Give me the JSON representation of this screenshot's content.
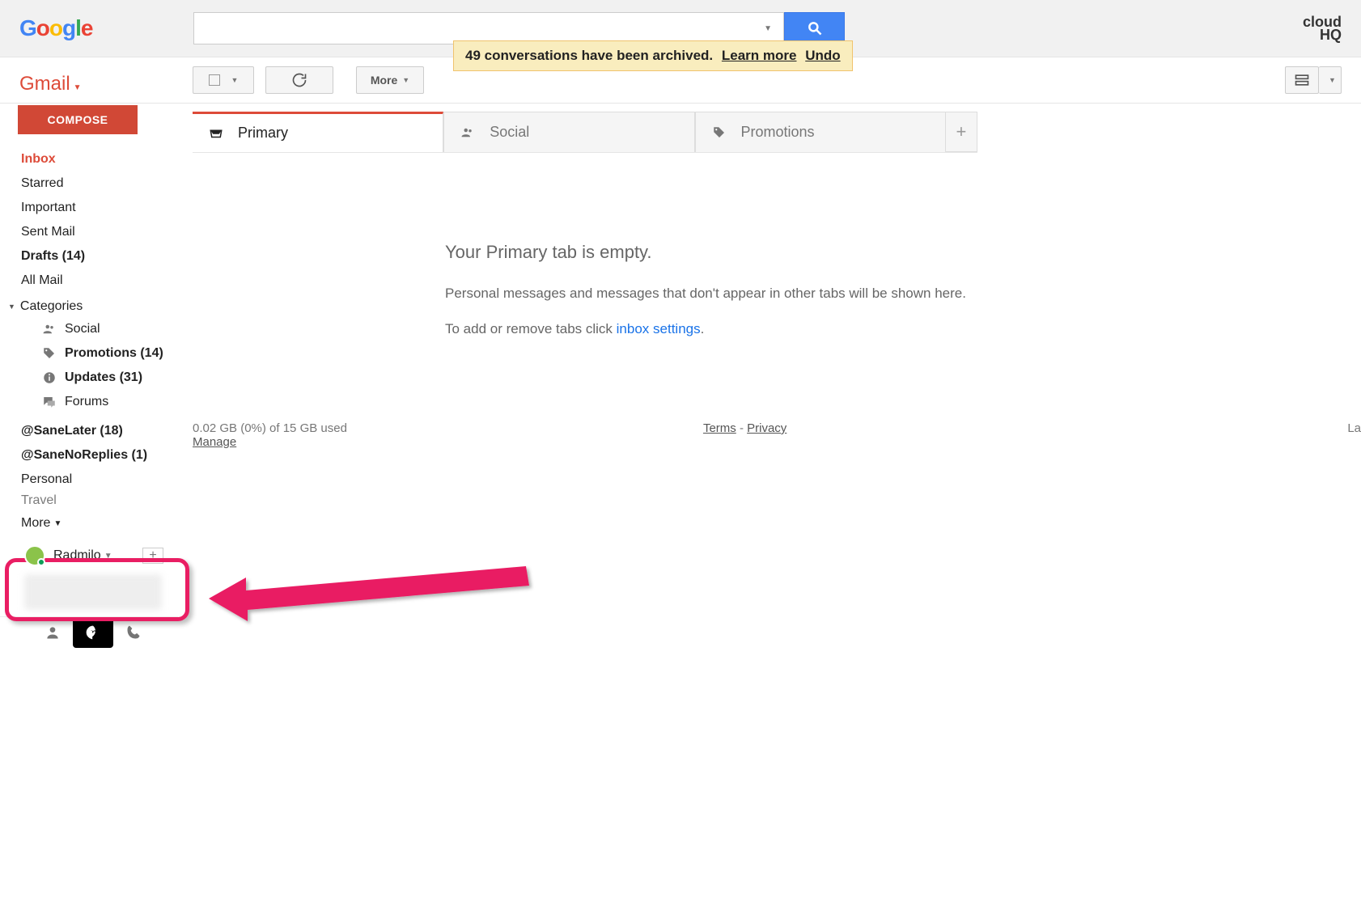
{
  "header": {
    "logo_text": "Google",
    "cloudhq_line1": "cloud",
    "cloudhq_line2": "HQ"
  },
  "notification": {
    "message": "49 conversations have been archived.",
    "learn_more": "Learn more",
    "undo": "Undo"
  },
  "toolbar": {
    "more_label": "More"
  },
  "gmail_label": "Gmail",
  "compose_label": "COMPOSE",
  "nav": {
    "inbox": "Inbox",
    "starred": "Starred",
    "important": "Important",
    "sent": "Sent Mail",
    "drafts": "Drafts (14)",
    "allmail": "All Mail",
    "categories": "Categories",
    "social": "Social",
    "promotions": "Promotions (14)",
    "updates": "Updates (31)",
    "forums": "Forums",
    "sanelater": "@SaneLater (18)",
    "sanenoreplies": "@SaneNoReplies (1)",
    "personal": "Personal",
    "travel": "Travel",
    "more": "More"
  },
  "hangouts": {
    "name": "Radmilo",
    "add_icon": "+"
  },
  "tabs": {
    "primary": "Primary",
    "social": "Social",
    "promotions": "Promotions"
  },
  "empty_state": {
    "title": "Your Primary tab is empty.",
    "body1": "Personal messages and messages that don't appear in other tabs will be shown here.",
    "body2a": "To add or remove tabs click ",
    "body2b": "inbox settings",
    "body2c": "."
  },
  "footer": {
    "storage": "0.02 GB (0%) of 15 GB used",
    "manage": "Manage",
    "terms": "Terms",
    "dash": " - ",
    "privacy": "Privacy",
    "last": "La"
  }
}
